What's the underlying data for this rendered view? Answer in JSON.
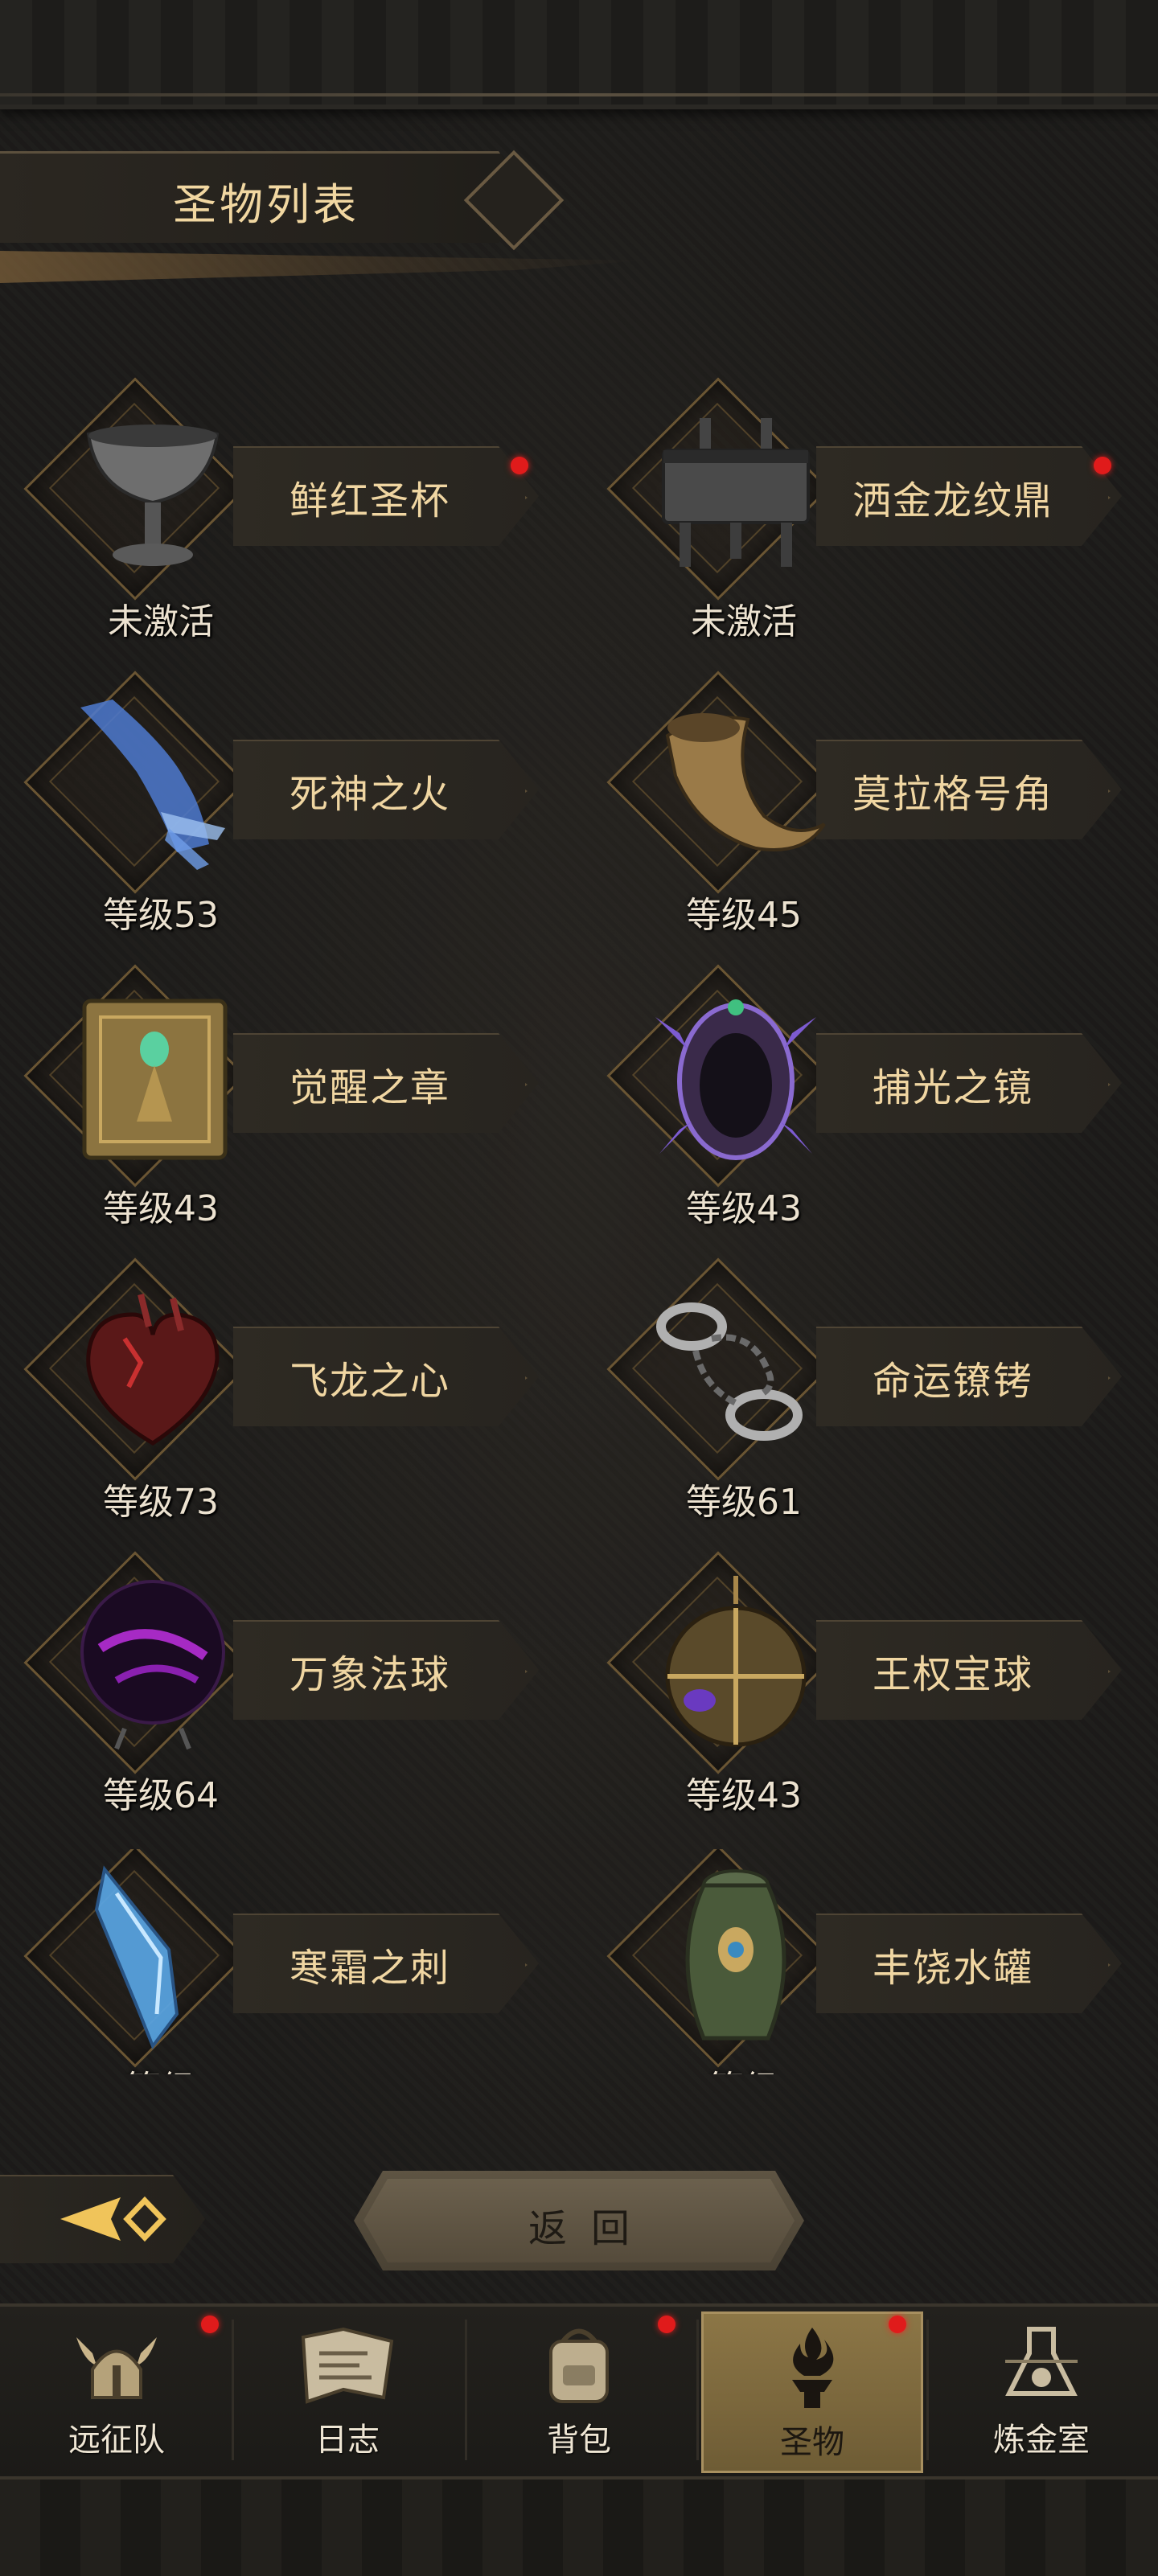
{
  "header": {
    "title": "圣物列表"
  },
  "relics": [
    {
      "name": "鲜红圣杯",
      "status": "未激活",
      "badge": true,
      "icon": "chalice-icon",
      "color": "#8a8a8a"
    },
    {
      "name": "洒金龙纹鼎",
      "status": "未激活",
      "badge": true,
      "icon": "cauldron-icon",
      "color": "#7a7a7a"
    },
    {
      "name": "死神之火",
      "status": "等级53",
      "badge": false,
      "icon": "ghost-hand-icon",
      "color": "#5e8ad8"
    },
    {
      "name": "莫拉格号角",
      "status": "等级45",
      "badge": false,
      "icon": "horn-icon",
      "color": "#b4935c"
    },
    {
      "name": "觉醒之章",
      "status": "等级43",
      "badge": false,
      "icon": "tome-icon",
      "color": "#a98a4a"
    },
    {
      "name": "捕光之镜",
      "status": "等级43",
      "badge": false,
      "icon": "mirror-icon",
      "color": "#7c5bd0"
    },
    {
      "name": "飞龙之心",
      "status": "等级73",
      "badge": false,
      "icon": "dragon-heart-icon",
      "color": "#8c2424"
    },
    {
      "name": "命运镣铐",
      "status": "等级61",
      "badge": false,
      "icon": "shackles-icon",
      "color": "#9a9a9a"
    },
    {
      "name": "万象法球",
      "status": "等级64",
      "badge": false,
      "icon": "orb-icon",
      "color": "#a028c8"
    },
    {
      "name": "王权宝球",
      "status": "等级43",
      "badge": false,
      "icon": "globus-icon",
      "color": "#a8874a"
    },
    {
      "name": "寒霜之刺",
      "status": "等级",
      "badge": false,
      "icon": "ice-shard-icon",
      "color": "#6ab4e8"
    },
    {
      "name": "丰饶水罐",
      "status": "等级",
      "badge": false,
      "icon": "vase-icon",
      "color": "#7a8a5a"
    }
  ],
  "back_button": {
    "label": "返回"
  },
  "nav": [
    {
      "label": "远征队",
      "icon": "viking-helmet-icon",
      "badge": true,
      "active": false
    },
    {
      "label": "日志",
      "icon": "scroll-map-icon",
      "badge": false,
      "active": false
    },
    {
      "label": "背包",
      "icon": "backpack-icon",
      "badge": true,
      "active": false
    },
    {
      "label": "圣物",
      "icon": "relic-flame-icon",
      "badge": true,
      "active": true
    },
    {
      "label": "炼金室",
      "icon": "alchemy-icon",
      "badge": false,
      "active": false
    }
  ],
  "colors": {
    "accent": "#e01b1b",
    "text_gold": "#f0d6a2",
    "active_tab": "#8c7646"
  }
}
